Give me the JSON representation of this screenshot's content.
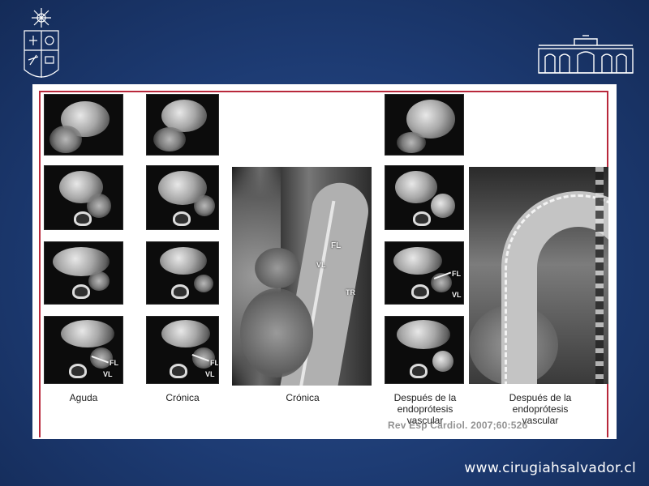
{
  "figure": {
    "columns": [
      {
        "caption": "Aguda"
      },
      {
        "caption": "Crónica"
      },
      {
        "caption": "Crónica"
      },
      {
        "caption": "Después de la endoprótesis vascular"
      },
      {
        "caption": "Después de la endoprótesis vascular"
      }
    ],
    "labels": {
      "fl": "FL",
      "vl": "VL",
      "tr": "TR"
    },
    "citation": "Rev Esp Cardiol. 2007;60:526"
  },
  "footer": {
    "url": "www.cirugiahsalvador.cl"
  },
  "colors": {
    "background": "#1d3b73",
    "frame_accent": "#b8283b"
  },
  "icons": {
    "left_logo": "university-crest-icon",
    "right_logo": "hospital-building-icon"
  }
}
